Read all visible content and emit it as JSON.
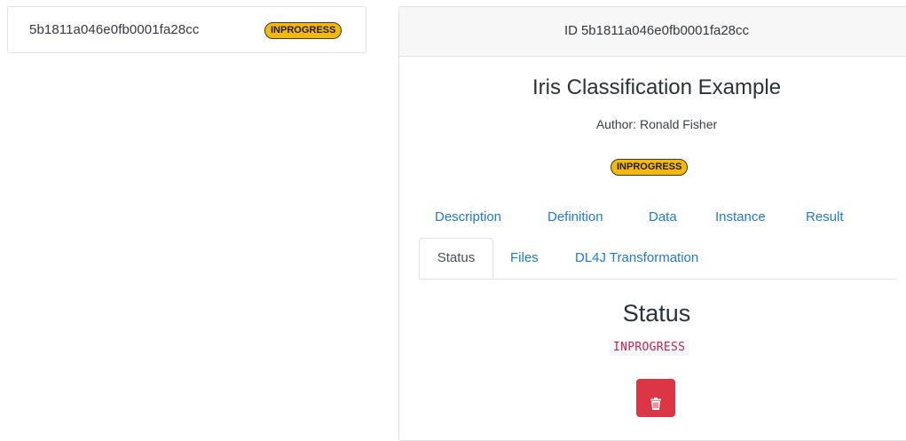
{
  "job_list": {
    "items": [
      {
        "id": "5b1811a046e0fb0001fa28cc",
        "status": "INPROGRESS"
      }
    ]
  },
  "detail": {
    "header": {
      "prefix": "ID",
      "id": "5b1811a046e0fb0001fa28cc"
    },
    "title": "Iris Classification Example",
    "author_label": "Author:",
    "author": "Ronald Fisher",
    "status_badge": "INPROGRESS",
    "tabs_row1": [
      "Description",
      "Definition",
      "Data",
      "Instance",
      "Result"
    ],
    "tabs_row2": [
      "Status",
      "Files",
      "DL4J Transformation"
    ],
    "active_tab": "Status",
    "status_section": {
      "heading": "Status",
      "value": "INPROGRESS"
    },
    "delete_icon": "trash-icon"
  },
  "colors": {
    "badge_bg": "#f5b80a",
    "link": "#1e7ad9",
    "danger": "#dc3545",
    "code_text": "#c7254e"
  }
}
